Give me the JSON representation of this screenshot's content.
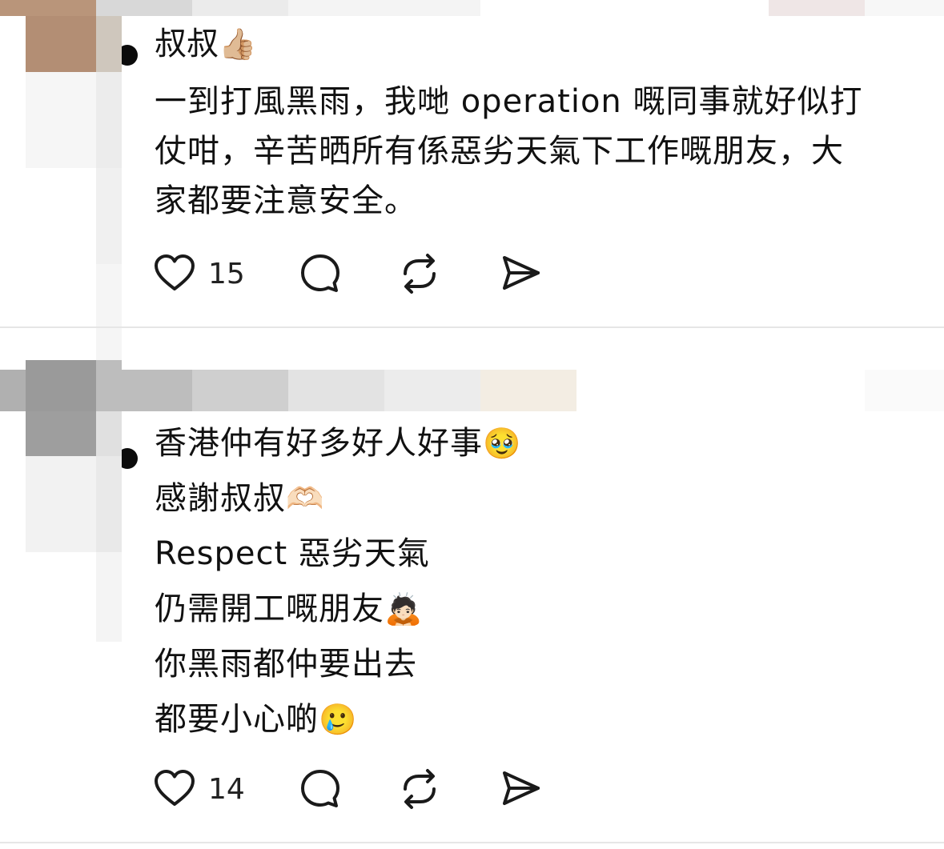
{
  "posts": [
    {
      "author": "叔叔",
      "author_emoji": "👍🏼",
      "text": "一到打風黑雨，我哋 operation 嘅同事就好似打\n仗咁，辛苦晒所有係惡劣天氣下工作嘅朋友，大\n家都要注意安全。",
      "likes": "15"
    },
    {
      "lines": [
        {
          "text": "香港仲有好多好人好事",
          "emoji": "🥹"
        },
        {
          "text": "感謝叔叔",
          "emoji": "🫶🏻"
        },
        {
          "text": "Respect 惡劣天氣",
          "emoji": ""
        },
        {
          "text": "仍需開工嘅朋友",
          "emoji": "🙇🏻"
        },
        {
          "text": "你黑雨都仲要出去",
          "emoji": ""
        },
        {
          "text": "都要小心啲",
          "emoji": "🥲"
        }
      ],
      "likes": "14"
    }
  ],
  "icons": {
    "like": "heart-icon",
    "reply": "comment-bubble-icon",
    "repost": "repost-icon",
    "share": "send-icon"
  },
  "colors": {
    "icon": "#1a1a1a",
    "divider": "#e6e6e6"
  }
}
